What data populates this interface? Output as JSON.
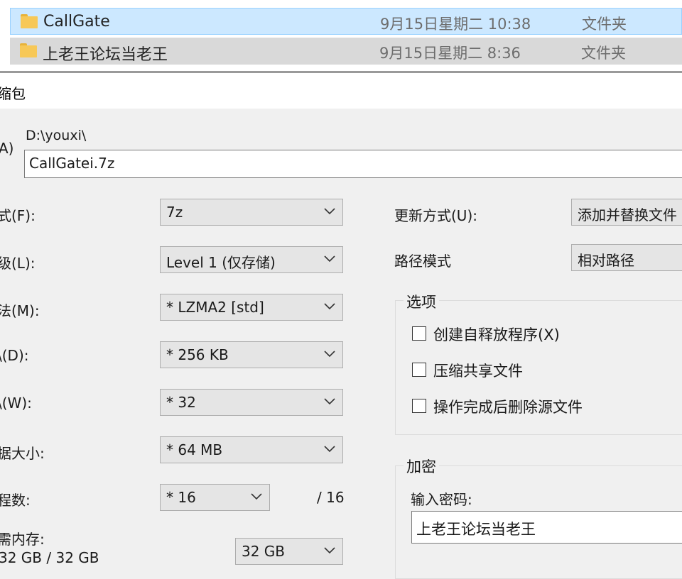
{
  "explorer": {
    "rows": [
      {
        "name": "CallGate",
        "date": "9月15日星期二 10:38",
        "type": "文件夹"
      },
      {
        "name": "上老王论坛当老王",
        "date": "9月15日星期二 8:36",
        "type": "文件夹"
      }
    ]
  },
  "dialog": {
    "title": "缩包",
    "archive_label": "A)",
    "archive_dir": "D:\\youxi\\",
    "archive_name": "CallGatei.7z",
    "left_fields": [
      {
        "label": "式(F):",
        "value": "7z"
      },
      {
        "label": "级(L):",
        "value": "Level 1 (仅存储)"
      },
      {
        "label": "法(M):",
        "value": "*  LZMA2 [std]"
      },
      {
        "label": "\\(D):",
        "value": "*  256 KB"
      },
      {
        "label": "\\(W):",
        "value": "*  32"
      },
      {
        "label": "据大小:",
        "value": "*  64 MB"
      }
    ],
    "threads": {
      "label": "程数:",
      "value": "*  16",
      "max": "/ 16"
    },
    "memory": {
      "label": "需内存:",
      "usage": "32 GB / 32 GB",
      "value": "32 GB"
    },
    "update_mode": {
      "label": "更新方式(U):",
      "value": "添加并替换文件"
    },
    "path_mode": {
      "label": "路径模式",
      "value": "相对路径"
    },
    "options": {
      "title": "选项",
      "items": [
        "创建自释放程序(X)",
        "压缩共享文件",
        "操作完成后删除源文件"
      ]
    },
    "encryption": {
      "title": "加密",
      "password_label": "输入密码:",
      "password_value": "上老王论坛当老王"
    }
  }
}
